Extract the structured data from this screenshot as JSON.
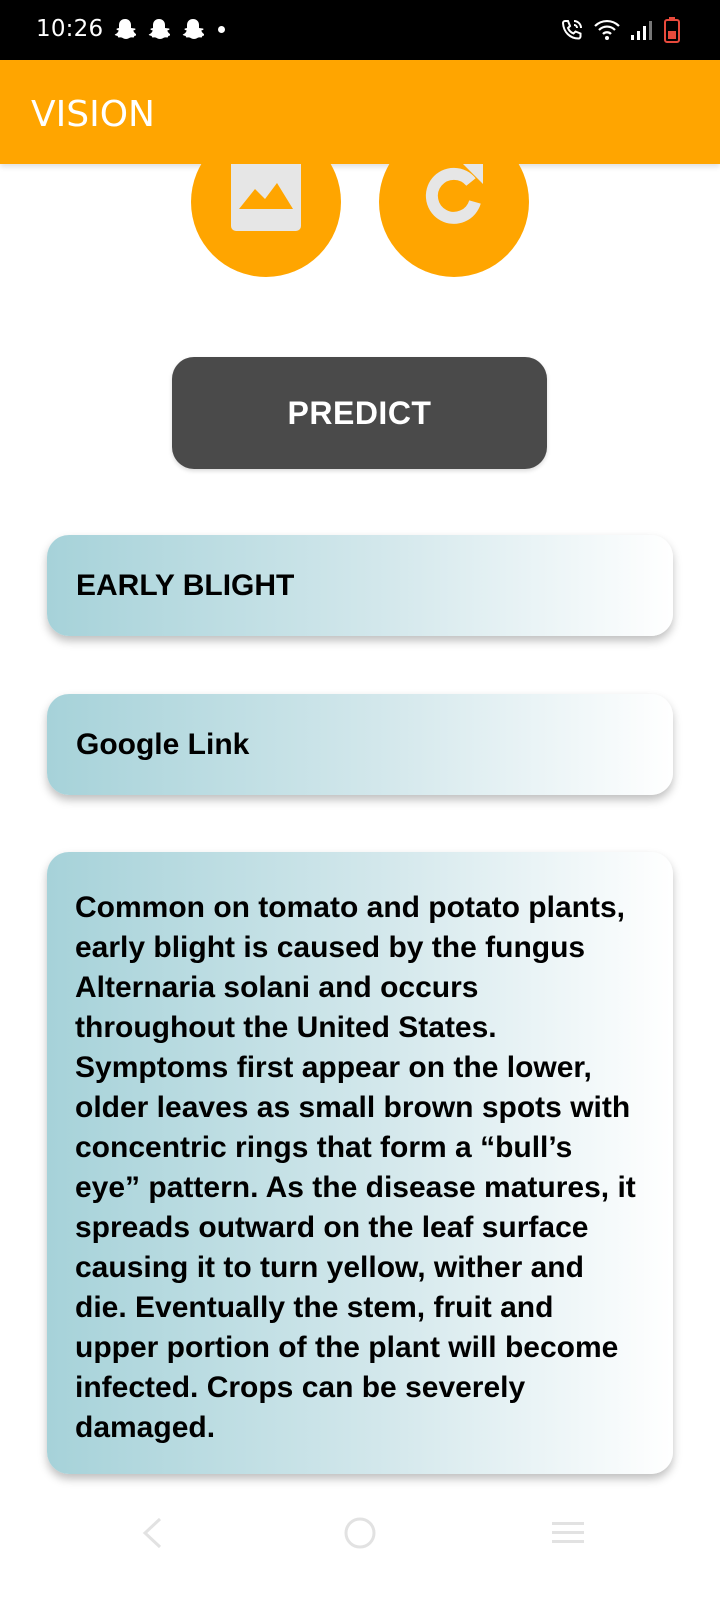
{
  "status_bar": {
    "time": "10:26",
    "notification_icons": [
      "snapchat-icon",
      "snapchat-icon",
      "snapchat-icon",
      "dot-icon"
    ],
    "right_icons": [
      "wifi-calling-icon",
      "wifi-icon",
      "signal-icon",
      "battery-icon"
    ]
  },
  "app_bar": {
    "title": "VISION",
    "color": "#ffa500"
  },
  "actions": {
    "gallery_icon": "image-icon",
    "refresh_icon": "refresh-icon",
    "predict_label": "PREDICT"
  },
  "result": {
    "prediction": "EARLY BLIGHT",
    "link_label": "Google Link",
    "description": "Common on tomato and potato plants, early blight is caused by the fungus Alternaria solani and occurs throughout the United States. Symptoms first appear on the lower, older leaves as small brown spots with concentric rings that form a “bull’s eye” pattern. As the disease matures, it spreads outward on the leaf surface causing it to turn yellow, wither and die. Eventually the stem, fruit and upper portion of the plant will become infected. Crops can be severely damaged."
  },
  "nav_bar": {
    "icons": [
      "back-icon",
      "home-icon",
      "menu-icon"
    ]
  }
}
